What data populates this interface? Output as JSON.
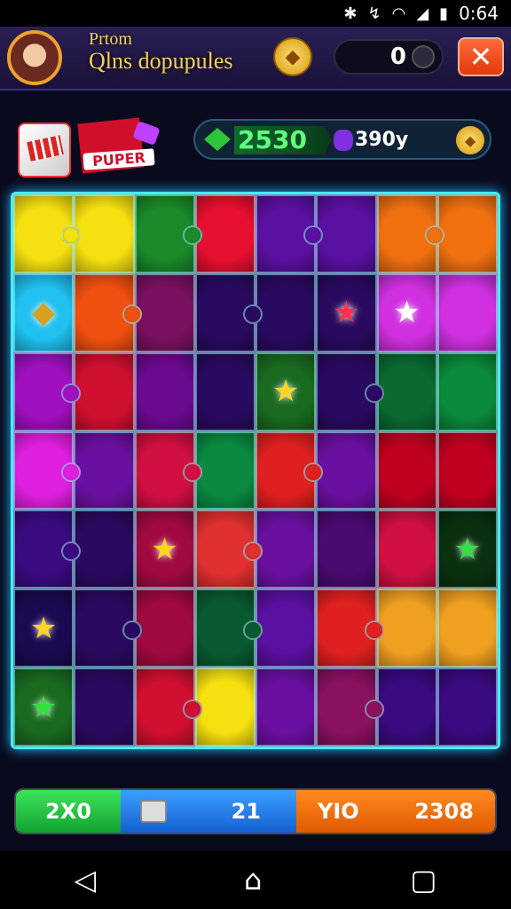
{
  "status_bar": {
    "time": "0:64",
    "icons": [
      "settings-icon",
      "network-icon",
      "wifi-icon",
      "signal-icon",
      "battery-icon"
    ]
  },
  "header": {
    "title_line1": "Prtom",
    "title_line2": "Qlns dopupules",
    "coin_symbol": "◆",
    "score": "0",
    "close_symbol": "✕"
  },
  "boosters": {
    "card_label": "PUPER"
  },
  "resources": {
    "green_value": "2530",
    "purple_value": "390y",
    "coin_symbol": "◆"
  },
  "board": {
    "rows": 7,
    "cols": 8,
    "tiles": [
      {
        "c": "#f5e010",
        "k": 1
      },
      {
        "c": "#f5e010"
      },
      {
        "c": "#1a8a2a",
        "k": 1
      },
      {
        "c": "#e81030"
      },
      {
        "c": "#5a10a0",
        "k": 1
      },
      {
        "c": "#5a10a0"
      },
      {
        "c": "#f07010",
        "k": 1
      },
      {
        "c": "#f07010"
      },
      {
        "c": "#20c0f0",
        "s": "gem"
      },
      {
        "c": "#f05010",
        "k": 1
      },
      {
        "c": "#7a1060"
      },
      {
        "c": "#2a0a60",
        "k": 1
      },
      {
        "c": "#2a0a60"
      },
      {
        "c": "#2a0a60",
        "s": "star-small"
      },
      {
        "c": "#d030e0",
        "s": "star-white"
      },
      {
        "c": "#d030e0"
      },
      {
        "c": "#a010c0",
        "k": 1
      },
      {
        "c": "#d01030"
      },
      {
        "c": "#6a0a90"
      },
      {
        "c": "#2a0a60"
      },
      {
        "c": "#1a6a20",
        "s": "star"
      },
      {
        "c": "#2a0a60",
        "k": 1
      },
      {
        "c": "#0a6a30"
      },
      {
        "c": "#0a8a3a"
      },
      {
        "c": "#e020e0",
        "k": 1
      },
      {
        "c": "#6a10a0"
      },
      {
        "c": "#d01040",
        "k": 1
      },
      {
        "c": "#0a8a40"
      },
      {
        "c": "#e02020",
        "k": 1
      },
      {
        "c": "#6a10a0"
      },
      {
        "c": "#c00020"
      },
      {
        "c": "#c00020"
      },
      {
        "c": "#3a0a80",
        "k": 1
      },
      {
        "c": "#2a0a60"
      },
      {
        "c": "#a00a40",
        "s": "star"
      },
      {
        "c": "#e03030",
        "k": 1
      },
      {
        "c": "#6a10a0"
      },
      {
        "c": "#4a0a70"
      },
      {
        "c": "#d01040"
      },
      {
        "c": "#0a3010",
        "s": "star-green"
      },
      {
        "c": "#1a0a50",
        "s": "star"
      },
      {
        "c": "#2a0a60",
        "k": 1
      },
      {
        "c": "#a00a40"
      },
      {
        "c": "#0a5a30",
        "k": 1
      },
      {
        "c": "#5a10a0"
      },
      {
        "c": "#e02020",
        "k": 1
      },
      {
        "c": "#f0a020"
      },
      {
        "c": "#f0a020"
      },
      {
        "c": "#1a6a20",
        "s": "star-green"
      },
      {
        "c": "#2a0a60"
      },
      {
        "c": "#d01030",
        "k": 1
      },
      {
        "c": "#f5e010"
      },
      {
        "c": "#6a10a0"
      },
      {
        "c": "#8a1060",
        "k": 1
      },
      {
        "c": "#3a0a80"
      },
      {
        "c": "#3a0a80"
      }
    ]
  },
  "bottom_bar": {
    "green_label": "2X0",
    "blue_value": "21",
    "orange_label": "YIO",
    "orange_value": "2308"
  },
  "navigation": {
    "back": "◁",
    "home": "⌂",
    "recents": "▢"
  }
}
